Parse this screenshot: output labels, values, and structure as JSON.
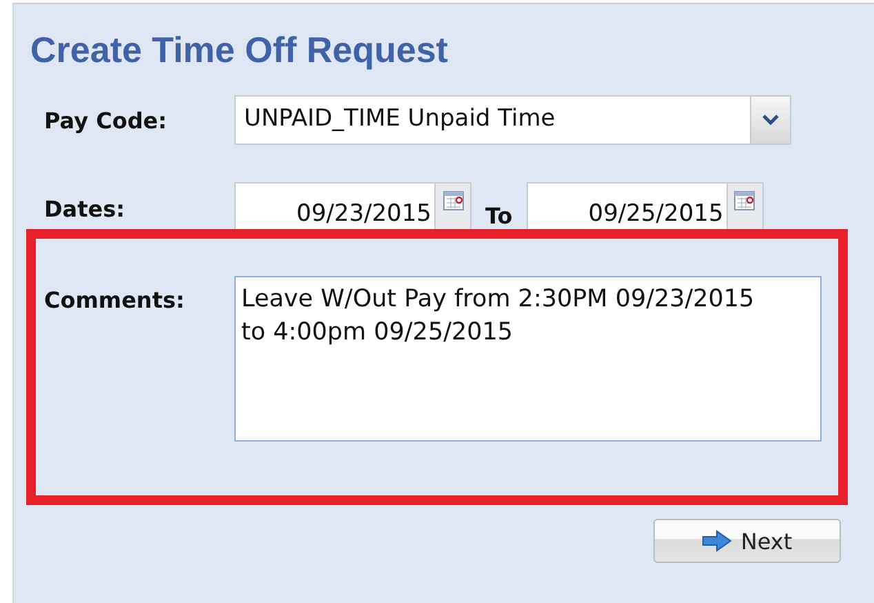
{
  "title": "Create Time Off Request",
  "pay_code": {
    "label": "Pay Code:",
    "value": "UNPAID_TIME Unpaid Time"
  },
  "dates": {
    "label": "Dates:",
    "from": "09/23/2015",
    "separator": "To",
    "to": "09/25/2015"
  },
  "comments": {
    "label": "Comments:",
    "value": "Leave W/Out Pay from 2:30PM 09/23/2015 to 4:00pm 09/25/2015"
  },
  "highlight": {
    "color": "#e8202a"
  },
  "buttons": [
    {
      "label": "Next"
    }
  ]
}
